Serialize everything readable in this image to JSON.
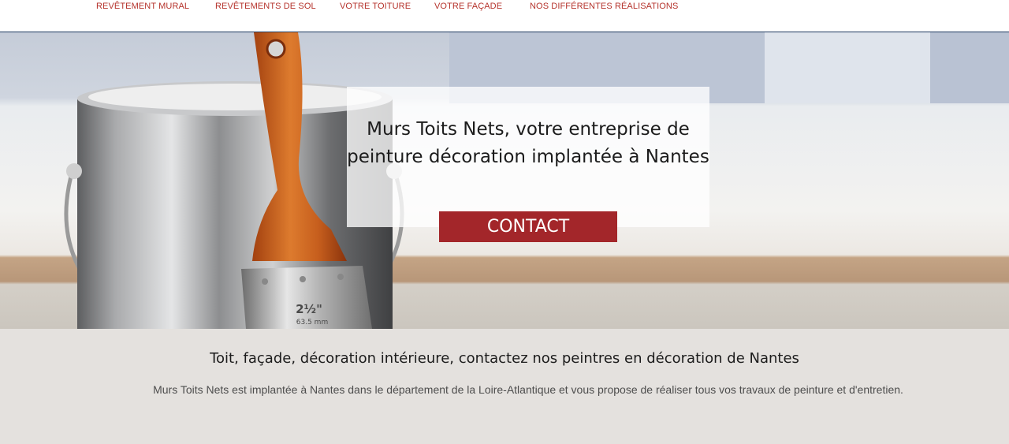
{
  "nav": {
    "items": [
      {
        "label": "Revêtement mural"
      },
      {
        "label": "Revêtements de sol"
      },
      {
        "label": "Votre toiture"
      },
      {
        "label": "Votre façade"
      },
      {
        "label": "Nos différentes réalisations"
      }
    ]
  },
  "hero": {
    "title": "Murs Toits Nets, votre entreprise de peinture décoration implantée à Nantes",
    "button_label": "CONTACT",
    "brush_label_size": "2½\"",
    "brush_label_mm": "63.5 mm"
  },
  "intro": {
    "heading": "Toit, façade, décoration intérieure, contactez nos peintres en décoration de Nantes",
    "text": "Murs Toits Nets est implantée à Nantes dans le département de la Loire-Atlantique et vous propose de réaliser tous vos travaux de peinture et d'entretien."
  },
  "colors": {
    "nav_text": "#b5322b",
    "nav_border": "#1f3a60",
    "button_bg": "#a3262a",
    "section_bg": "#e4e1de"
  }
}
